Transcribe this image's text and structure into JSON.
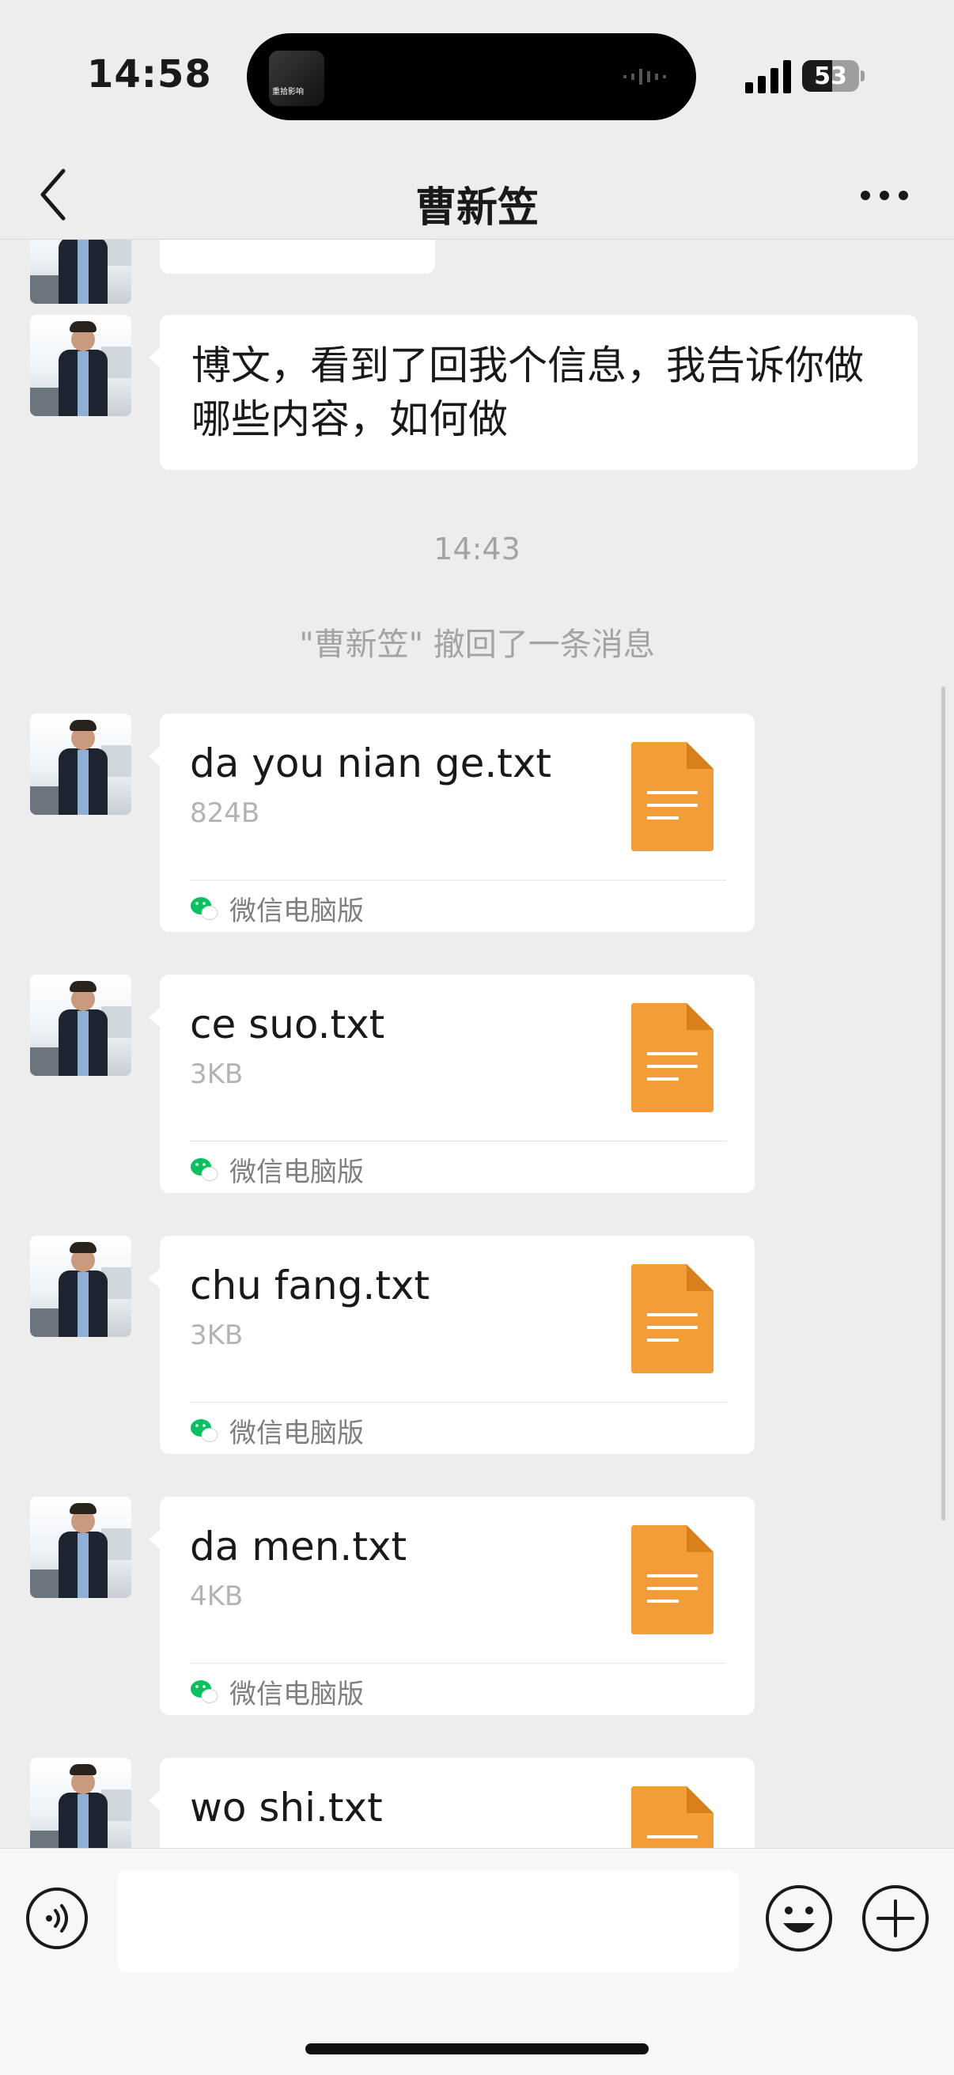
{
  "status_bar": {
    "time": "14:58",
    "island_thumb_text": "重拾影响",
    "battery": "53",
    "battery_level_percent": 53
  },
  "nav": {
    "title": "曹新笠",
    "back_icon": "chevron-left-icon",
    "more_icon": "more-horizontal-icon"
  },
  "chat": {
    "text_message": "博文，看到了回我个信息，我告诉你做哪些内容，如何做",
    "time_separator": "14:43",
    "recall_notice": "\"曹新笠\" 撤回了一条消息",
    "files": [
      {
        "name": "da you nian ge.txt",
        "size": "824B",
        "source": "微信电脑版"
      },
      {
        "name": "ce suo.txt",
        "size": "3KB",
        "source": "微信电脑版"
      },
      {
        "name": "chu fang.txt",
        "size": "3KB",
        "source": "微信电脑版"
      },
      {
        "name": "da men.txt",
        "size": "4KB",
        "source": "微信电脑版"
      },
      {
        "name": "wo shi.txt",
        "size": "",
        "source": ""
      }
    ]
  },
  "input_bar": {
    "voice_icon": "voice-icon",
    "emoji_icon": "emoji-icon",
    "plus_icon": "plus-icon",
    "message_value": ""
  },
  "colors": {
    "background": "#ededed",
    "bubble": "#ffffff",
    "file_icon": "#f29d38",
    "wechat_green": "#07c160"
  }
}
